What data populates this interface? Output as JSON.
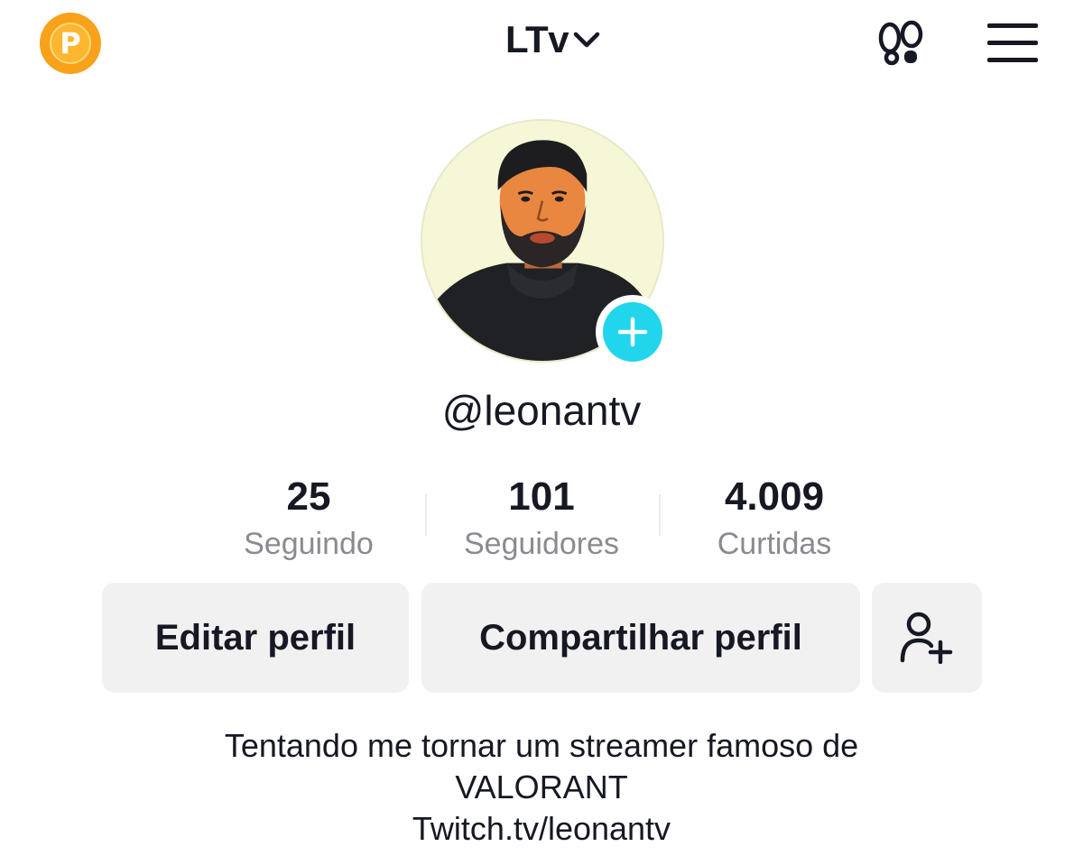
{
  "header": {
    "coin_letter": "P",
    "title": "LTv",
    "title_dropdown_icon": "chevron-down-icon",
    "footprints_icon": "footprints-icon",
    "menu_icon": "hamburger-menu-icon"
  },
  "profile": {
    "username": "@leonantv",
    "add_avatar_icon": "plus-icon",
    "accent_color": "#20d5ec"
  },
  "stats": [
    {
      "value": "25",
      "label": "Seguindo"
    },
    {
      "value": "101",
      "label": "Seguidores"
    },
    {
      "value": "4.009",
      "label": "Curtidas"
    }
  ],
  "actions": {
    "edit_label": "Editar perfil",
    "share_label": "Compartilhar perfil",
    "add_friend_icon": "add-user-icon"
  },
  "bio": {
    "line1": "Tentando me tornar um streamer famoso de",
    "line2": "VALORANT",
    "line3": "Twitch.tv/leonantv"
  }
}
